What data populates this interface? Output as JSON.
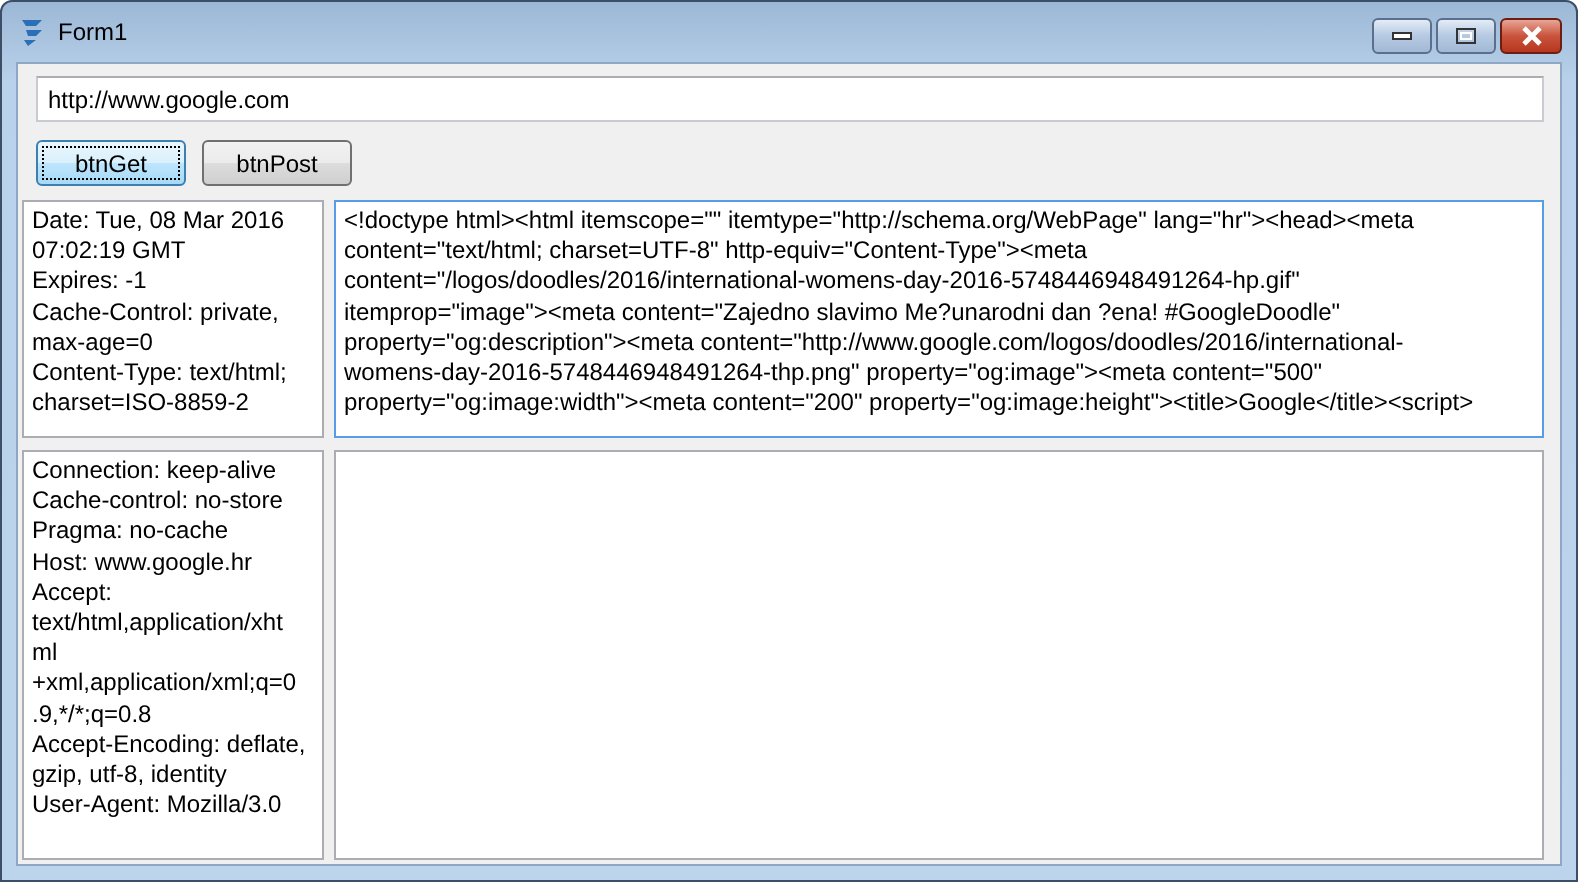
{
  "window": {
    "title": "Form1"
  },
  "url_field": {
    "value": "http://www.google.com"
  },
  "buttons": [
    {
      "label": "btnGet",
      "focused": true
    },
    {
      "label": "btnPost",
      "focused": false
    }
  ],
  "response_headers": {
    "lines": [
      "Date: Tue, 08 Mar 2016",
      "07:02:19 GMT",
      "Expires: -1",
      "Cache-Control: private,",
      "max-age=0",
      "Content-Type: text/html;",
      "charset=ISO-8859-2"
    ]
  },
  "response_body": {
    "lines": [
      "<!doctype html><html itemscope=\"\" itemtype=\"http://schema.org/WebPage\" lang=\"hr\"><head><meta",
      "content=\"text/html; charset=UTF-8\" http-equiv=\"Content-Type\"><meta",
      "content=\"/logos/doodles/2016/international-womens-day-2016-5748446948491264-hp.gif\"",
      "itemprop=\"image\"><meta content=\"Zajedno slavimo Me?unarodni dan ?ena! #GoogleDoodle\"",
      "property=\"og:description\"><meta content=\"http://www.google.com/logos/doodles/2016/international-",
      "womens-day-2016-5748446948491264-thp.png\" property=\"og:image\"><meta content=\"500\"",
      "property=\"og:image:width\"><meta content=\"200\" property=\"og:image:height\"><title>Google</title><script>"
    ]
  },
  "request_headers": {
    "lines": [
      "Connection: keep-alive",
      "Cache-control: no-store",
      "Pragma: no-cache",
      "Host: www.google.hr",
      "Accept:",
      "text/html,application/xht",
      "ml",
      "+xml,application/xml;q=0",
      ".9,*/*;q=0.8",
      "Accept-Encoding: deflate,",
      "gzip, utf-8, identity",
      "User-Agent: Mozilla/3.0"
    ]
  }
}
